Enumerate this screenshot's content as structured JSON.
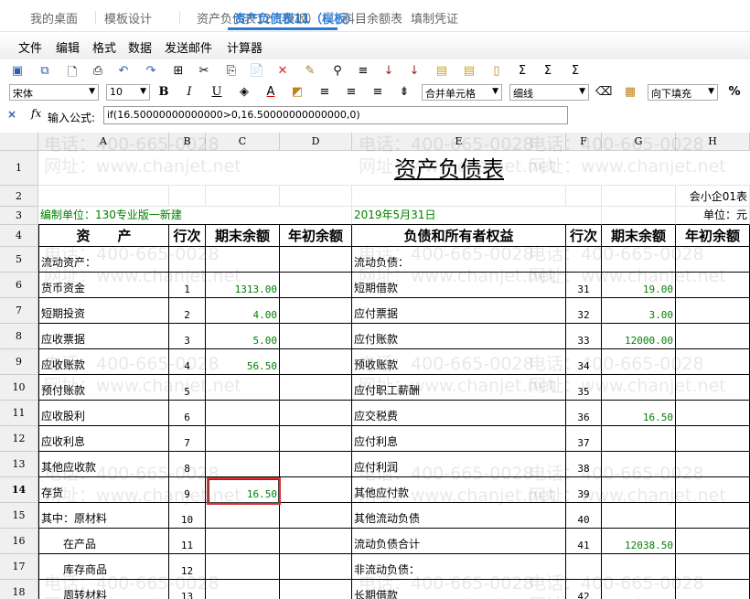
{
  "tabs": [
    "我的桌面",
    "模板设计",
    "资产负债表12（模板）",
    "资产负债表11（模板）",
    "科目余额表",
    "填制凭证"
  ],
  "active_tab": 3,
  "menu": [
    "文件",
    "编辑",
    "格式",
    "数据",
    "发送邮件",
    "计算器"
  ],
  "toolbar2": {
    "font": "宋体",
    "size": "10",
    "merge": "合并单元格",
    "border": "细线",
    "fill": "向下填充",
    "percent": "%"
  },
  "formula": {
    "label": "输入公式:",
    "value": "if(16.50000000000000>0,16.50000000000000,0)"
  },
  "watermark": [
    "电话：400-665-0028",
    "网址：www.chanjet.net"
  ],
  "columns": [
    "A",
    "B",
    "C",
    "D",
    "E",
    "F",
    "G",
    "H"
  ],
  "sheet": {
    "title": "资产负债表",
    "form_code": "会小企01表",
    "company": "编制单位：130专业版一新建",
    "date": "2019年5月31日",
    "unit": "单位：元",
    "headers": [
      "资　　产",
      "行次",
      "期末余额",
      "年初余额",
      "负债和所有者权益",
      "行次",
      "期末余额",
      "年初余额"
    ],
    "rows": [
      [
        "流动资产：",
        "",
        "",
        "",
        "流动负债：",
        "",
        "",
        ""
      ],
      [
        "货币资金",
        "1",
        "1313.00",
        "",
        "短期借款",
        "31",
        "19.00",
        ""
      ],
      [
        "短期投资",
        "2",
        "4.00",
        "",
        "应付票据",
        "32",
        "3.00",
        ""
      ],
      [
        "应收票据",
        "3",
        "5.00",
        "",
        "应付账款",
        "33",
        "12000.00",
        ""
      ],
      [
        "应收账款",
        "4",
        "56.50",
        "",
        "预收账款",
        "34",
        "",
        ""
      ],
      [
        "预付账款",
        "5",
        "",
        "",
        "应付职工薪酬",
        "35",
        "",
        ""
      ],
      [
        "应收股利",
        "6",
        "",
        "",
        "应交税费",
        "36",
        "16.50",
        ""
      ],
      [
        "应收利息",
        "7",
        "",
        "",
        "应付利息",
        "37",
        "",
        ""
      ],
      [
        "其他应收款",
        "8",
        "",
        "",
        "应付利润",
        "38",
        "",
        ""
      ],
      [
        "存货",
        "9",
        "16.50",
        "",
        "其他应付款",
        "39",
        "",
        ""
      ],
      [
        "其中：原材料",
        "10",
        "",
        "",
        "其他流动负债",
        "40",
        "",
        ""
      ],
      [
        "　　在产品",
        "11",
        "",
        "",
        "流动负债合计",
        "41",
        "12038.50",
        ""
      ],
      [
        "　　库存商品",
        "12",
        "",
        "",
        "非流动负债：",
        "",
        "",
        ""
      ],
      [
        "　　周转材料",
        "13",
        "",
        "",
        "长期借款",
        "42",
        "",
        ""
      ]
    ]
  }
}
